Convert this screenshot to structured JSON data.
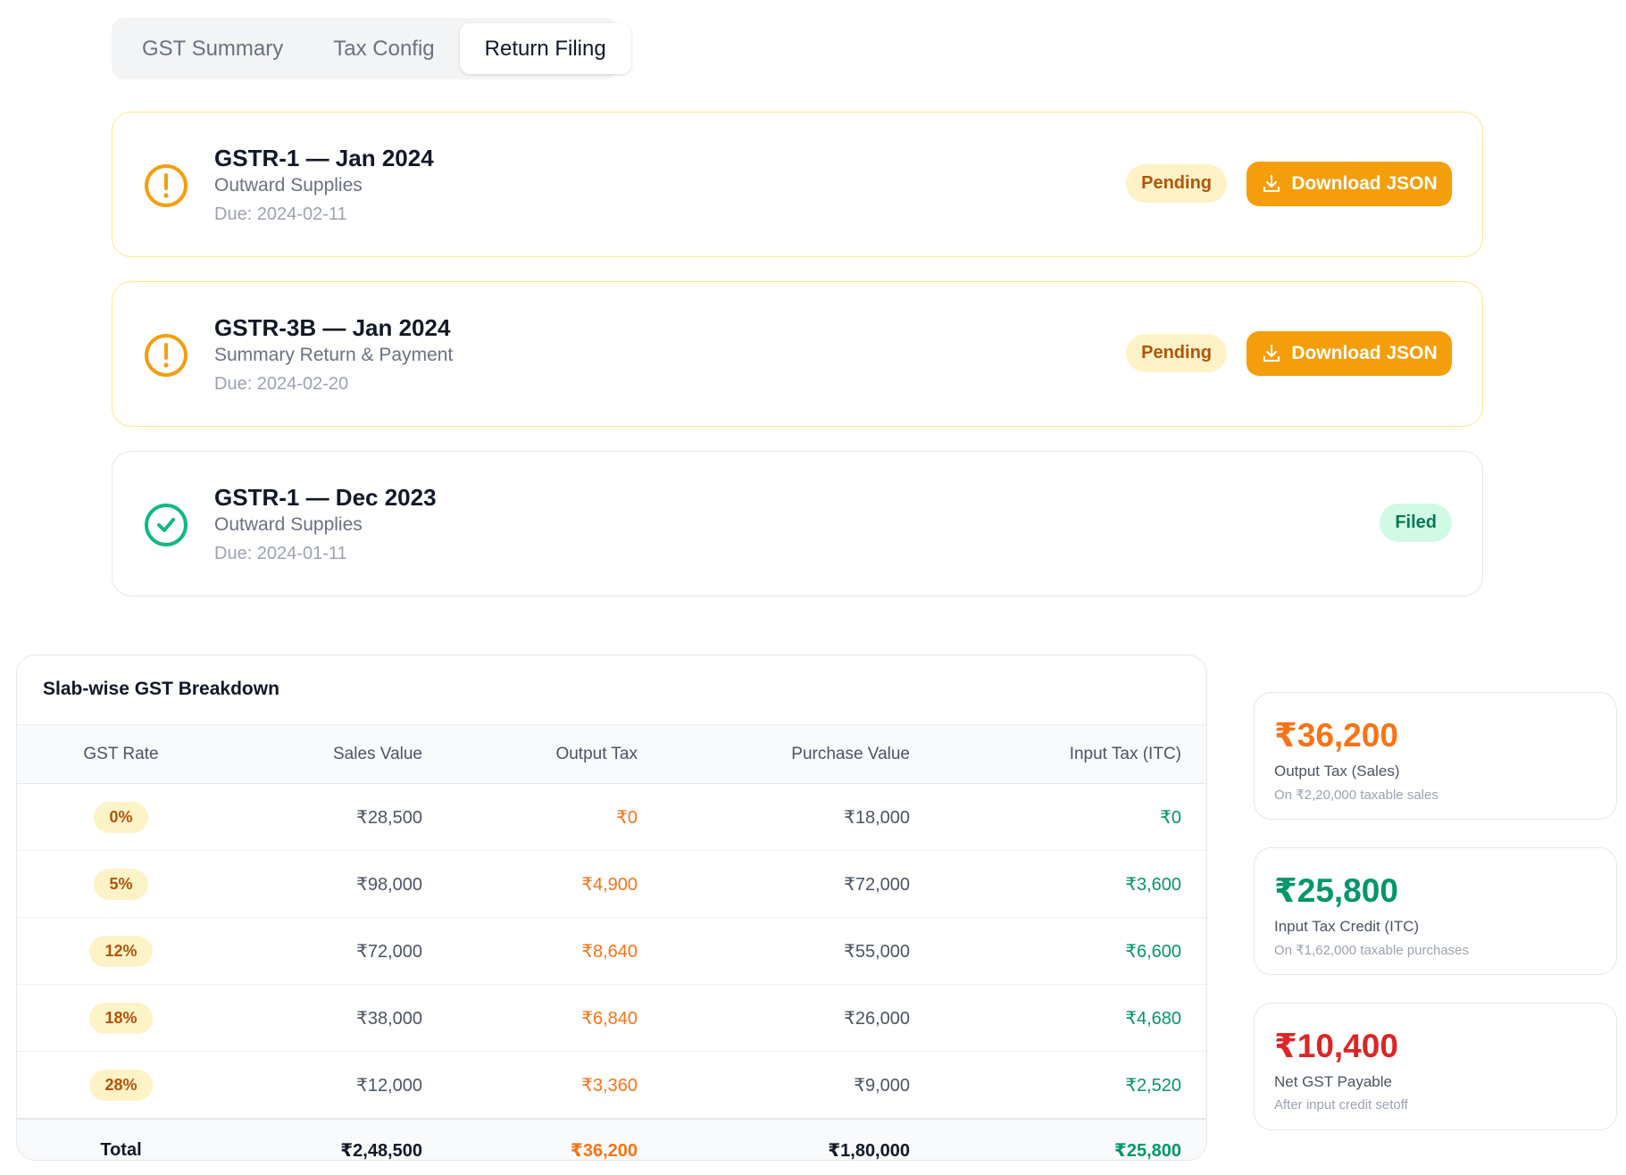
{
  "tabs": [
    {
      "label": "GST Summary",
      "active": false
    },
    {
      "label": "Tax Config",
      "active": false
    },
    {
      "label": "Return Filing",
      "active": true
    }
  ],
  "returns": [
    {
      "title": "GSTR-1 — Jan 2024",
      "subtitle": "Outward Supplies",
      "due": "Due: 2024-02-11",
      "status": "Pending",
      "action": "Download JSON"
    },
    {
      "title": "GSTR-3B — Jan 2024",
      "subtitle": "Summary Return & Payment",
      "due": "Due: 2024-02-20",
      "status": "Pending",
      "action": "Download JSON"
    },
    {
      "title": "GSTR-1 — Dec 2023",
      "subtitle": "Outward Supplies",
      "due": "Due: 2024-01-11",
      "status": "Filed"
    }
  ],
  "slab": {
    "title": "Slab-wise GST Breakdown",
    "headers": [
      "GST Rate",
      "Sales Value",
      "Output Tax",
      "Purchase Value",
      "Input Tax (ITC)"
    ],
    "rows": [
      [
        "0%",
        "₹28,500",
        "₹0",
        "₹18,000",
        "₹0"
      ],
      [
        "5%",
        "₹98,000",
        "₹4,900",
        "₹72,000",
        "₹3,600"
      ],
      [
        "12%",
        "₹72,000",
        "₹8,640",
        "₹55,000",
        "₹6,600"
      ],
      [
        "18%",
        "₹38,000",
        "₹6,840",
        "₹26,000",
        "₹4,680"
      ],
      [
        "28%",
        "₹12,000",
        "₹3,360",
        "₹9,000",
        "₹2,520"
      ]
    ],
    "total": [
      "Total",
      "₹2,48,500",
      "₹36,200",
      "₹1,80,000",
      "₹25,800"
    ]
  },
  "stats": [
    {
      "value": "₹36,200",
      "label": "Output Tax (Sales)",
      "note": "On ₹2,20,000 taxable sales",
      "color": "#f97316"
    },
    {
      "value": "₹25,800",
      "label": "Input Tax Credit (ITC)",
      "note": "On ₹1,62,000 taxable purchases",
      "color": "#059669"
    },
    {
      "value": "₹10,400",
      "label": "Net GST Payable",
      "note": "After input credit setoff",
      "color": "#dc2626"
    }
  ],
  "colors": {
    "warning": "#f59e0b",
    "success": "#10b981",
    "output": "#f97316",
    "input": "#059669",
    "payable": "#dc2626"
  },
  "icons": {
    "pending": "alert-circle-icon",
    "filed": "check-circle-icon",
    "download": "download-icon"
  }
}
